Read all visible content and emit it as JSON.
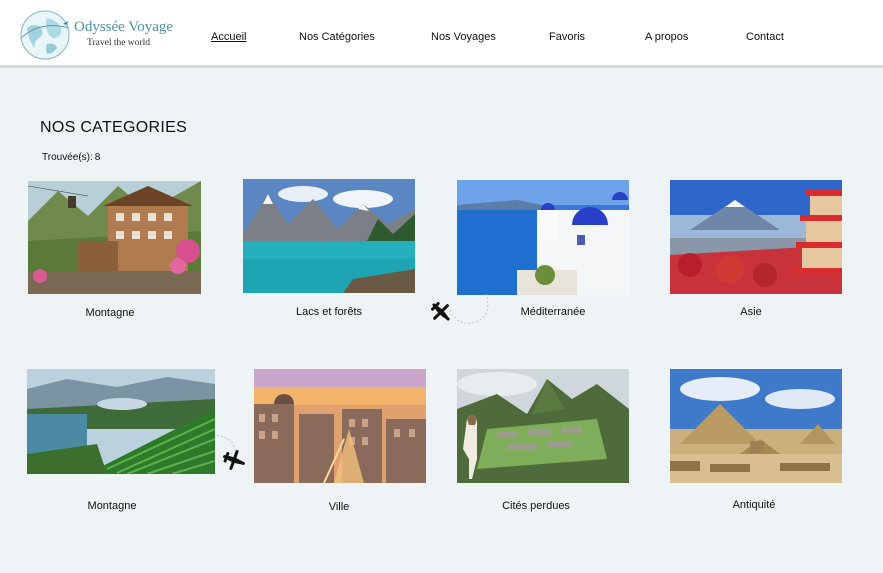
{
  "brand": {
    "name": "Odyssée Voyage",
    "tagline": "Travel the world"
  },
  "nav": [
    {
      "label": "Accueil",
      "active": true
    },
    {
      "label": "Nos Catégories"
    },
    {
      "label": "Nos Voyages"
    },
    {
      "label": "Favoris"
    },
    {
      "label": "A propos"
    },
    {
      "label": "Contact"
    }
  ],
  "main": {
    "title": "NOS CATEGORIES",
    "count_label": "Trouvée(s):",
    "count_value": "8"
  },
  "categories": [
    {
      "label": "Montagne",
      "image": "alpine-chalet"
    },
    {
      "label": "Lacs et forêts",
      "image": "mountain-lake"
    },
    {
      "label": "Méditerranée",
      "image": "santorini"
    },
    {
      "label": "Asie",
      "image": "fuji-pagoda"
    },
    {
      "label": "Montagne",
      "image": "tea-terraces"
    },
    {
      "label": "Ville",
      "image": "city-sunset"
    },
    {
      "label": "Cités perdues",
      "image": "machu-picchu-llama"
    },
    {
      "label": "Antiquité",
      "image": "pyramids"
    }
  ],
  "colors": {
    "brand": "#4f8fa6",
    "background": "#eef3f5",
    "header": "#ffffff"
  },
  "icons": [
    "globe-logo-icon",
    "airplane-icon"
  ]
}
